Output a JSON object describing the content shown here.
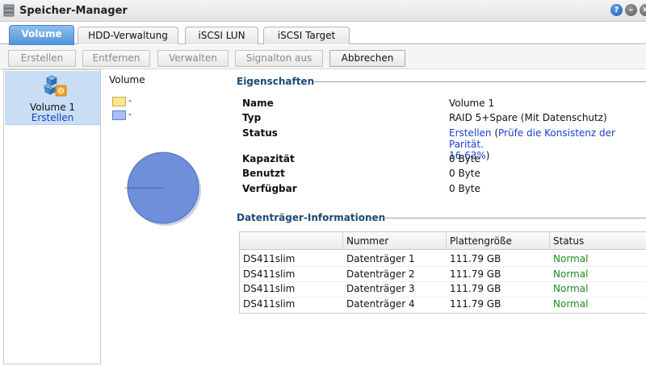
{
  "app": {
    "title": "Speicher-Manager"
  },
  "tabs": [
    {
      "label": "Volume",
      "active": true
    },
    {
      "label": "HDD-Verwaltung",
      "active": false
    },
    {
      "label": "iSCSI LUN",
      "active": false
    },
    {
      "label": "iSCSI Target",
      "active": false
    }
  ],
  "toolbar": {
    "create": "Erstellen",
    "remove": "Entfernen",
    "manage": "Verwalten",
    "beep_off": "Signalton aus",
    "cancel": "Abbrechen"
  },
  "volumes": [
    {
      "name": "Volume 1",
      "status": "Erstellen"
    }
  ],
  "chart": {
    "title": "Volume",
    "legend": [
      {
        "label": "-",
        "color": "#ffe58a"
      },
      {
        "label": "-",
        "color": "#a8bef0"
      }
    ],
    "pie_color": "#6f8fdb"
  },
  "properties": {
    "section_title": "Eigenschaften",
    "rows": [
      {
        "label": "Name",
        "value": "Volume 1"
      },
      {
        "label": "Typ",
        "value": "RAID 5+Spare (Mit Datenschutz)"
      },
      {
        "label": "Status",
        "value_link": "Erstellen",
        "value_open": " (",
        "value_link2": "Prüfe die Konsistenz der Parität.",
        "value_line2": "16.63%",
        "value_close": ")"
      },
      {
        "label": "Kapazität",
        "value": "0 Byte"
      },
      {
        "label": "Benutzt",
        "value": "0 Byte"
      },
      {
        "label": "Verfügbar",
        "value": "0 Byte"
      }
    ]
  },
  "disks": {
    "section_title": "Datenträger-Informationen",
    "columns": [
      "",
      "Nummer",
      "Plattengröße",
      "Status"
    ],
    "rows": [
      {
        "device": "DS411slim",
        "number": "Datenträger 1",
        "size": "111.79 GB",
        "status": "Normal"
      },
      {
        "device": "DS411slim",
        "number": "Datenträger 2",
        "size": "111.79 GB",
        "status": "Normal"
      },
      {
        "device": "DS411slim",
        "number": "Datenträger 3",
        "size": "111.79 GB",
        "status": "Normal"
      },
      {
        "device": "DS411slim",
        "number": "Datenträger 4",
        "size": "111.79 GB",
        "status": "Normal"
      }
    ]
  }
}
